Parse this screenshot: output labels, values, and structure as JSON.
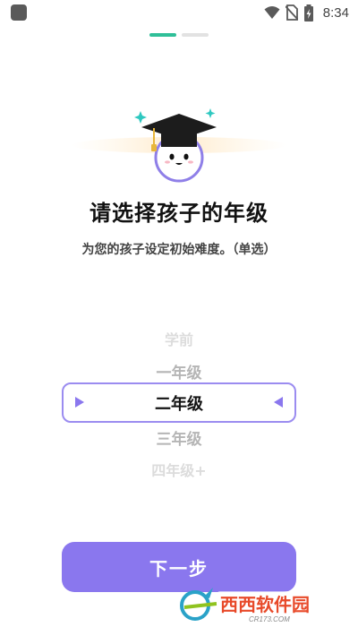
{
  "status_bar": {
    "time": "8:34",
    "icons": [
      "wifi-icon",
      "no-sim-icon",
      "battery-charging-icon"
    ]
  },
  "pager": {
    "count": 2,
    "active_index": 0
  },
  "title": "请选择孩子的年级",
  "subtitle": "为您的孩子设定初始难度。（单选）",
  "picker": {
    "options": [
      "学前",
      "一年级",
      "二年级",
      "三年级",
      "四年级+"
    ],
    "selected": "二年级"
  },
  "next_button": {
    "label": "下一步"
  },
  "watermark": {
    "brand": "西西软件园",
    "url": "CR173.COM"
  },
  "colors": {
    "accent": "#8a77ee",
    "selector_border": "#9b8cf0",
    "pager_active": "#2fbf98",
    "text": "#111111"
  }
}
